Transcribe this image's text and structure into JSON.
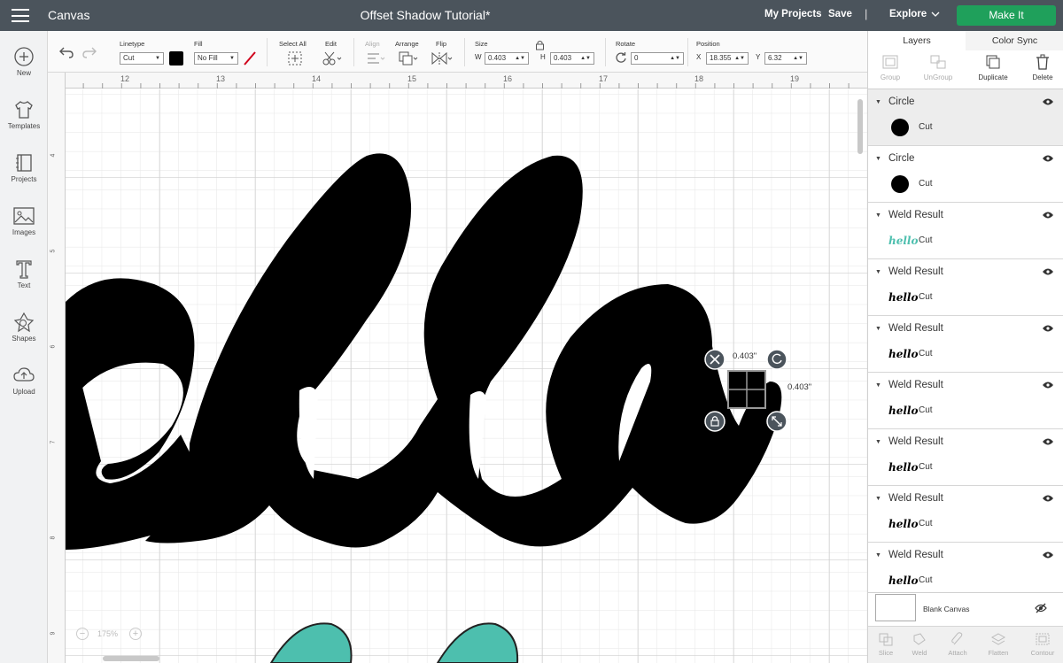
{
  "topbar": {
    "app_title": "Canvas",
    "doc_title": "Offset Shadow Tutorial*",
    "my_projects": "My Projects",
    "save": "Save",
    "separator": "|",
    "explore": "Explore",
    "make_it": "Make It",
    "make_it_color": "#1fa05b",
    "bar_color": "#4b545c"
  },
  "sidebar": {
    "items": [
      {
        "label": "New",
        "icon": "plus-circle-icon"
      },
      {
        "label": "Templates",
        "icon": "tshirt-icon"
      },
      {
        "label": "Projects",
        "icon": "notebook-icon"
      },
      {
        "label": "Images",
        "icon": "image-icon"
      },
      {
        "label": "Text",
        "icon": "text-t-icon"
      },
      {
        "label": "Shapes",
        "icon": "shapes-icon"
      },
      {
        "label": "Upload",
        "icon": "cloud-upload-icon"
      }
    ]
  },
  "toolbar": {
    "linetype_label": "Linetype",
    "linetype_value": "Cut",
    "fill_label": "Fill",
    "fill_value": "No Fill",
    "select_all_label": "Select All",
    "edit_label": "Edit",
    "align_label": "Align",
    "arrange_label": "Arrange",
    "flip_label": "Flip",
    "size_label": "Size",
    "w_label": "W",
    "w_value": "0.403",
    "h_label": "H",
    "h_value": "0.403",
    "rotate_label": "Rotate",
    "rotate_value": "0",
    "position_label": "Position",
    "x_label": "X",
    "x_value": "18.355",
    "y_label": "Y",
    "y_value": "6.32"
  },
  "canvas": {
    "ruler_top": [
      "12",
      "13",
      "14",
      "15",
      "16",
      "17",
      "18",
      "19"
    ],
    "ruler_left": [
      "4",
      "5",
      "6",
      "7",
      "8",
      "9"
    ],
    "selection_width": "0.403\"",
    "selection_height": "0.403\"",
    "zoom": "175%",
    "shadow_color": "#000000",
    "teal_color": "#4dbfae"
  },
  "right_panel": {
    "tabs": [
      "Layers",
      "Color Sync"
    ],
    "actions": [
      "Group",
      "UnGroup",
      "Duplicate",
      "Delete"
    ],
    "layers": [
      {
        "name": "Circle",
        "type": "Cut",
        "thumb": "circle"
      },
      {
        "name": "Circle",
        "type": "Cut",
        "thumb": "circle"
      },
      {
        "name": "Weld Result",
        "type": "Cut",
        "thumb": "hello-teal",
        "thumb_text": "hello"
      },
      {
        "name": "Weld Result",
        "type": "Cut",
        "thumb": "hello-black",
        "thumb_text": "hello"
      },
      {
        "name": "Weld Result",
        "type": "Cut",
        "thumb": "hello-black",
        "thumb_text": "hello"
      },
      {
        "name": "Weld Result",
        "type": "Cut",
        "thumb": "hello-black",
        "thumb_text": "hello"
      },
      {
        "name": "Weld Result",
        "type": "Cut",
        "thumb": "hello-black",
        "thumb_text": "hello"
      },
      {
        "name": "Weld Result",
        "type": "Cut",
        "thumb": "hello-black",
        "thumb_text": "hello"
      },
      {
        "name": "Weld Result",
        "type": "Cut",
        "thumb": "hello-black",
        "thumb_text": "hello"
      }
    ],
    "blank_canvas": "Blank Canvas",
    "bottom_actions": [
      "Slice",
      "Weld",
      "Attach",
      "Flatten",
      "Contour"
    ]
  }
}
